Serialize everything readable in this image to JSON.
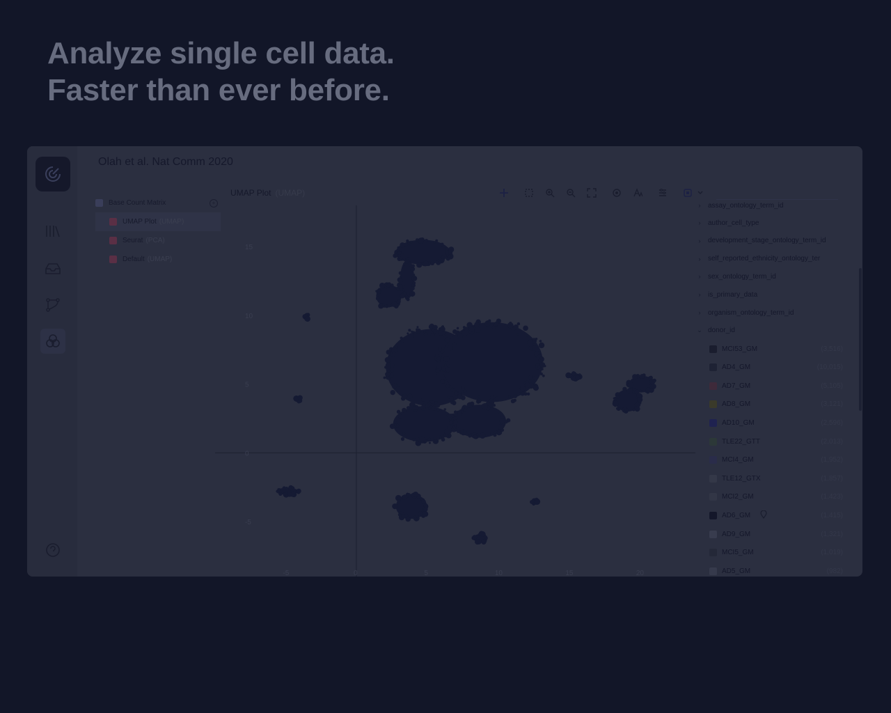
{
  "headline": {
    "line1": "Analyze single cell data.",
    "line2": "Faster than ever before."
  },
  "app": {
    "title": "Olah et al. Nat Comm 2020",
    "title_meta": "",
    "sidebar_icons": [
      "logo-icon",
      "library-icon",
      "inbox-icon",
      "workflow-icon",
      "datasets-icon",
      "help-icon"
    ],
    "tree": [
      {
        "label": "Base Count Matrix",
        "detail": "",
        "color": "#3a3e5a"
      },
      {
        "label": "UMAP Plot",
        "detail": "(UMAP)",
        "color": "#5a2f45"
      },
      {
        "label": "Seurat",
        "detail": "(PCA)",
        "color": "#5a2f45"
      },
      {
        "label": "Default",
        "detail": "(UMAP)",
        "color": "#5a2f45"
      }
    ],
    "plot": {
      "title": "UMAP Plot",
      "subtitle": "(UMAP)",
      "search_placeholder": ""
    },
    "legend": {
      "categories": [
        "author_cell_type",
        "development_stage_ontology_term_id",
        "self_reported_ethnicity_ontology_ter",
        "sex_ontology_term_id",
        "is_primary_data",
        "organism_ontology_term_id",
        "donor_id"
      ],
      "partial_top": "assay_ontology_term_id",
      "donors": [
        {
          "name": "MCI53_GM",
          "count": "(3,516)",
          "color": "#1a1d2e"
        },
        {
          "name": "AD4_GM",
          "count": "(10,015)",
          "color": "#1e2234"
        },
        {
          "name": "AD7_GM",
          "count": "(5,105)",
          "color": "#3e2a3a"
        },
        {
          "name": "AD8_GM",
          "count": "(3,121)",
          "color": "#3a3a2a"
        },
        {
          "name": "AD10_GM",
          "count": "(2,596)",
          "color": "#1f2250"
        },
        {
          "name": "TLE22_GTT",
          "count": "(2,013)",
          "color": "#2c3838"
        },
        {
          "name": "MCI4_GM",
          "count": "(1,952)",
          "color": "#2a2c4a"
        },
        {
          "name": "TLE12_GTX",
          "count": "(1,857)",
          "color": "#343848"
        },
        {
          "name": "MCI2_GM",
          "count": "(1,423)",
          "color": "#323646"
        },
        {
          "name": "AD6_GM",
          "count": "(1,415)",
          "color": "#14172a"
        },
        {
          "name": "AD9_GM",
          "count": "(1,321)",
          "color": "#383c4e"
        },
        {
          "name": "MCI5_GM",
          "count": "(1,019)",
          "color": "#242838"
        },
        {
          "name": "AD5_GM",
          "count": "(982)",
          "color": "#363a4c"
        }
      ]
    }
  },
  "chart_data": {
    "type": "scatter",
    "title": "UMAP Plot (UMAP)",
    "xlabel": "",
    "ylabel": "",
    "xlim": [
      -10,
      24
    ],
    "ylim": [
      -9,
      18
    ],
    "x_ticks": [
      -5,
      0,
      5,
      10,
      15,
      20
    ],
    "y_ticks": [
      -5,
      0,
      5,
      10,
      15
    ],
    "grid": false,
    "colors": {
      "points": "#151a33",
      "axis": "#1d2030",
      "text": "#3a3e50"
    },
    "clusters": [
      {
        "cx": 4.7,
        "cy": 14.6,
        "rx": 1.9,
        "ry": 0.9
      },
      {
        "cx": 3.6,
        "cy": 12.6,
        "rx": 0.5,
        "ry": 1.4
      },
      {
        "cx": 2.3,
        "cy": 11.4,
        "rx": 0.9,
        "ry": 0.8
      },
      {
        "cx": 5.3,
        "cy": 6.2,
        "rx": 3.2,
        "ry": 2.8
      },
      {
        "cx": 9.6,
        "cy": 6.6,
        "rx": 3.6,
        "ry": 2.9
      },
      {
        "cx": 4.8,
        "cy": 2.1,
        "rx": 2.2,
        "ry": 1.3
      },
      {
        "cx": 8.7,
        "cy": 2.3,
        "rx": 1.9,
        "ry": 1.2
      },
      {
        "cx": 20.2,
        "cy": 5.0,
        "rx": 0.9,
        "ry": 0.6
      },
      {
        "cx": 19.2,
        "cy": 3.8,
        "rx": 0.9,
        "ry": 0.8
      },
      {
        "cx": 3.9,
        "cy": -3.9,
        "rx": 1.1,
        "ry": 0.9
      },
      {
        "cx": 8.8,
        "cy": -6.2,
        "rx": 0.5,
        "ry": 0.3
      },
      {
        "cx": 15.4,
        "cy": 5.6,
        "rx": 0.45,
        "ry": 0.2
      },
      {
        "cx": 12.6,
        "cy": -3.5,
        "rx": 0.2,
        "ry": 0.2
      },
      {
        "cx": -4.9,
        "cy": -2.8,
        "rx": 0.8,
        "ry": 0.25
      },
      {
        "cx": -3.5,
        "cy": 9.9,
        "rx": 0.15,
        "ry": 0.15
      },
      {
        "cx": -4.1,
        "cy": 3.9,
        "rx": 0.15,
        "ry": 0.15
      }
    ]
  }
}
